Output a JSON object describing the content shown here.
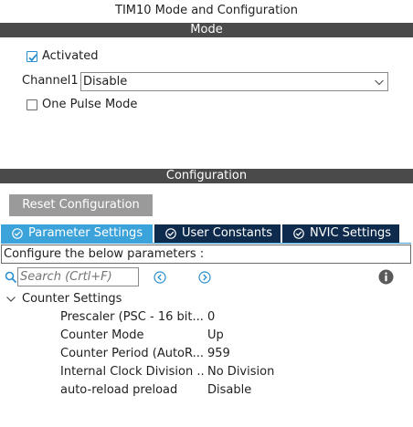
{
  "window": {
    "title": "TIM10 Mode and Configuration"
  },
  "mode_section": {
    "header": "Mode",
    "activated": {
      "label": "Activated",
      "checked": true
    },
    "channel1": {
      "label": "Channel1",
      "value": "Disable"
    },
    "one_pulse": {
      "label": "One Pulse Mode",
      "checked": false
    }
  },
  "config_section": {
    "header": "Configuration",
    "reset_button": "Reset Configuration",
    "tabs": [
      {
        "label": "Parameter Settings",
        "active": true
      },
      {
        "label": "User Constants",
        "active": false
      },
      {
        "label": "NVIC Settings",
        "active": false
      }
    ],
    "description": "Configure the below parameters :",
    "search": {
      "placeholder": "Search (Crtl+F)",
      "value": ""
    },
    "group": {
      "label": "Counter Settings",
      "expanded": true,
      "params": [
        {
          "name": "Prescaler (PSC - 16 bit...",
          "value": "0"
        },
        {
          "name": "Counter Mode",
          "value": "Up"
        },
        {
          "name": "Counter Period (AutoR...",
          "value": "959"
        },
        {
          "name": "Internal Clock Division ...",
          "value": "No Division"
        },
        {
          "name": "auto-reload preload",
          "value": "Disable"
        }
      ]
    }
  },
  "colors": {
    "section_bar": "#4a4a4a",
    "tab_active": "#3ba3d9",
    "tab_inactive": "#0e2a4c",
    "button_bg": "#9a9a9a",
    "accent": "#2a8fd1"
  }
}
